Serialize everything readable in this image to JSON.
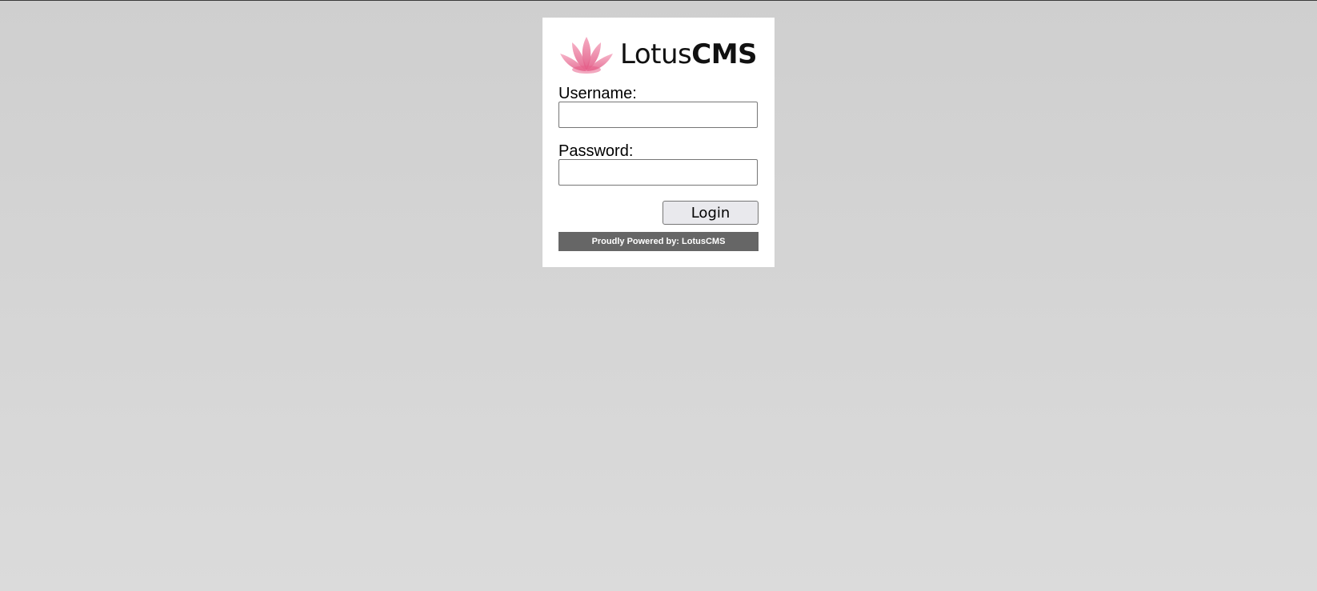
{
  "logo": {
    "brand_light": "Lotus",
    "brand_bold": "CMS",
    "icon": "lotus-flower-icon",
    "icon_color": "#e8608a"
  },
  "form": {
    "username_label": "Username:",
    "username_value": "",
    "password_label": "Password:",
    "password_value": "",
    "login_label": "Login"
  },
  "footer": {
    "text": "Proudly Powered by: LotusCMS",
    "background": "#666666"
  },
  "colors": {
    "page_background": "#d4d4d4",
    "card_background": "#ffffff"
  }
}
